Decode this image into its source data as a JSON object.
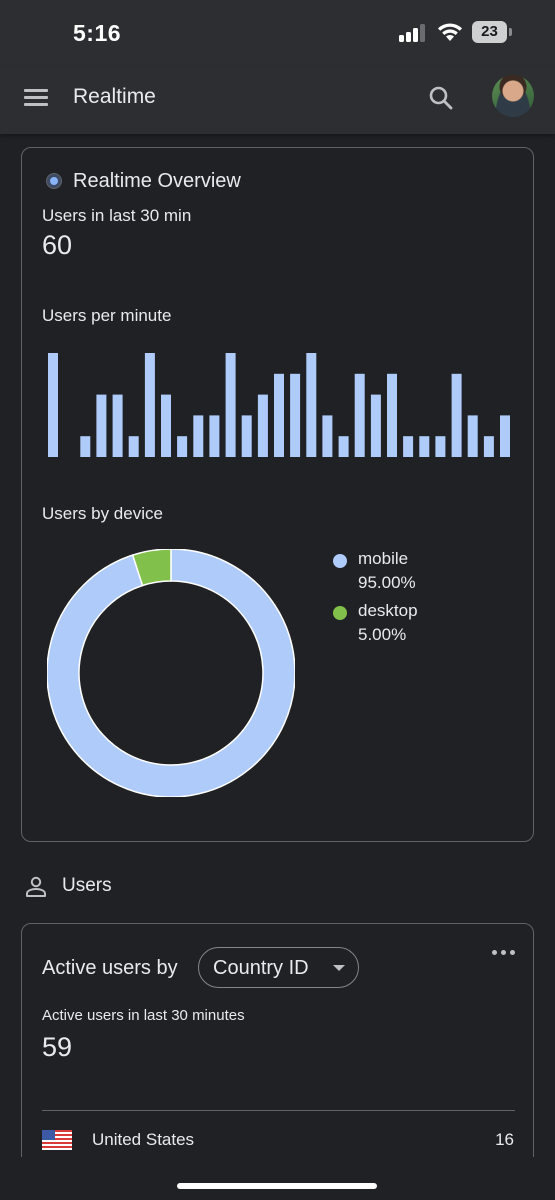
{
  "status_bar": {
    "time": "5:16",
    "battery_level": "23",
    "signal_bars_active": 3,
    "signal_bars_total": 4
  },
  "app_bar": {
    "title": "Realtime",
    "menu_icon": "menu-icon",
    "search_icon": "search-icon",
    "avatar": "user-avatar"
  },
  "overview": {
    "title": "Realtime Overview",
    "users_label": "Users in last 30 min",
    "users_value": "60",
    "per_minute_label": "Users per minute",
    "device_label": "Users by device"
  },
  "chart_data": [
    {
      "type": "bar",
      "title": "Users per minute",
      "values": [
        5,
        0,
        1,
        3,
        3,
        1,
        5,
        3,
        1,
        2,
        2,
        5,
        2,
        3,
        4,
        4,
        5,
        2,
        1,
        4,
        3,
        4,
        1,
        1,
        1,
        4,
        2,
        1,
        2
      ],
      "ylim": [
        0,
        5
      ],
      "color": "#aecbfa"
    },
    {
      "type": "pie",
      "title": "Users by device",
      "labels": [
        "mobile",
        "desktop"
      ],
      "values": [
        95.0,
        5.0
      ],
      "value_labels": [
        "95.00%",
        "5.00%"
      ],
      "colors": [
        "#aecbfa",
        "#81c04a"
      ],
      "legend_position": "right"
    }
  ],
  "users_section": {
    "title": "Users",
    "icon": "person-icon"
  },
  "active_users_card": {
    "heading": "Active users by",
    "dimension": "Country ID",
    "subtitle": "Active users in last 30 minutes",
    "value": "59",
    "more_icon": "more-horiz-icon",
    "rows": [
      {
        "flag": "us-flag-icon",
        "country": "United States",
        "value": "16"
      }
    ]
  },
  "colors": {
    "background": "#202124",
    "bar_surface": "#2d2e31",
    "accent_blue": "#aecbfa",
    "accent_green": "#81c04a",
    "border": "#5f6368"
  }
}
